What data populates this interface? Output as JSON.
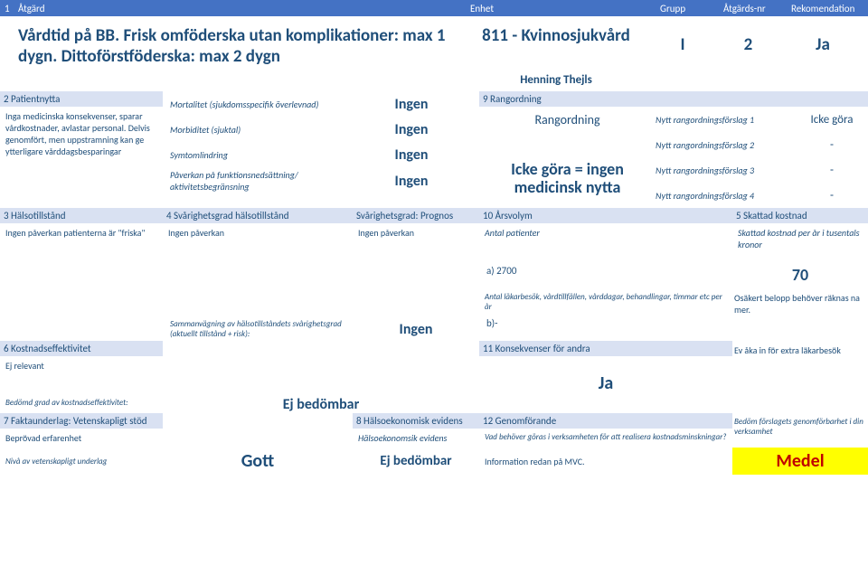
{
  "header": {
    "num": "1",
    "atgard": "Åtgärd",
    "enhet": "Enhet",
    "grupp": "Grupp",
    "nr": "Åtgärds-nr",
    "rek": "Rekomendation"
  },
  "title": "Vårdtid på BB. Frisk omföderska utan komplikationer: max 1 dygn. Dittoförstföderska: max 2 dygn",
  "enhet": {
    "main": "811 - Kvinnosjukvård",
    "sub": "Henning Thejls"
  },
  "top": {
    "grupp": "I",
    "nr": "2",
    "rek": "Ja"
  },
  "s2": {
    "head": "2  Patientnytta",
    "body": "Inga medicinska konsekvenser, sparar vårdkostnader, avlastar personal. Delvis genomfört, men uppstramning kan ge ytterligare vårddagsbesparingar"
  },
  "s4rows": [
    {
      "label": "Mortalitet (sjukdomsspecifik överlevnad)",
      "val": "Ingen"
    },
    {
      "label": "Morbiditet (sjuktal)",
      "val": "Ingen"
    },
    {
      "label": "Symtomlindring",
      "val": "Ingen"
    },
    {
      "label": "Påverkan på funktionsnedsättning/ aktivitetsbegränsning",
      "val": "Ingen"
    }
  ],
  "s9": {
    "head": "9  Rangordning",
    "rangord": "Rangordning",
    "center": "Icke göra = ingen medicinsk nytta",
    "rows": [
      {
        "mid": "Nytt rangordningsförslag 1",
        "right": "Icke göra"
      },
      {
        "mid": "Nytt rangordningsförslag 2",
        "right": "-"
      },
      {
        "mid": "Nytt rangordningsförslag 3",
        "right": "-"
      },
      {
        "mid": "Nytt rangordningsförslag 4",
        "right": "-"
      }
    ]
  },
  "s3": {
    "head": "3  Hälsotillstånd",
    "body": "Ingen påverkan patienterna är \"friska\""
  },
  "s4b": {
    "head": "4  Svårighetsgrad hälsotillstånd",
    "body": "Ingen påverkan"
  },
  "sPrognos": {
    "head": "Svårighetsgrad: Prognos",
    "body": "Ingen påverkan"
  },
  "s10": {
    "head": "10  Årsvolym",
    "body": "Antal patienter"
  },
  "s5": {
    "head": "5  Skattad kostnad",
    "body": "Skattad kostnad per år i tusentals kronor"
  },
  "vol": {
    "a": "a) 2700",
    "val70": "70",
    "note_mid": "Antal läkarbesök, vårdtillfällen, vårddagar, behandlingar, timmar etc per år",
    "note_right": "Osäkert belopp behöver räknas na mer."
  },
  "summ": {
    "label": "Sammanvägning av hälsotillståndets svårighetsgrad (aktuellt tillstånd + risk):",
    "val": "Ingen",
    "b": "b)-"
  },
  "s6": {
    "head": "6  Kostnadseffektivitet",
    "body": "Ej relevant"
  },
  "s11": {
    "head": "11  Konsekvenser för andra",
    "big": "Ja"
  },
  "right7": "Ev åka in för extra läkarbesök",
  "ejbed": {
    "label": "Bedömd grad av kostnadseffektivitet:",
    "val": "Ej bedömbar"
  },
  "s7": {
    "head": "7  Faktaunderlag: Vetenskapligt stöd",
    "body": "Beprövad erfarenhet"
  },
  "s8": {
    "head": "8  Hälsoekonomisk evidens",
    "body": "Hälsoekonomsik evidens"
  },
  "s12": {
    "head": "12  Genomförande",
    "body": "Vad behöver göras i verksamheten för att realisera kostnadsminskningar?"
  },
  "right8": "Bedöm förslagets genomförbarhet i din verksamhet",
  "final": {
    "label": "Nivå av vetenskapligt underlag",
    "gott": "Gott",
    "ejbed": "Ej bedömbar",
    "info": "Information redan på MVC.",
    "medel": "Medel"
  }
}
